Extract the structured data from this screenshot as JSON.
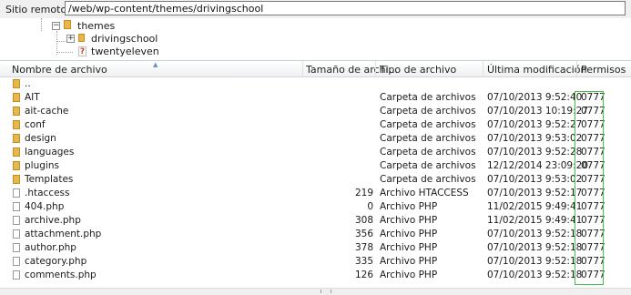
{
  "pathbar": {
    "label": "Sitio remoto:",
    "value": "/web/wp-content/themes/drivingschool"
  },
  "tree": {
    "nodes": [
      {
        "label": "themes",
        "icon": "folder-open-icon"
      },
      {
        "label": "drivingschool",
        "icon": "folder-icon",
        "expander": "+"
      },
      {
        "label": "twentyeleven",
        "icon": "unknown-folder-icon"
      }
    ]
  },
  "columns": {
    "name": "Nombre de archivo",
    "size": "Tamaño de archi...",
    "type": "Tipo de archivo",
    "modified": "Última modificación",
    "perms": "Permisos"
  },
  "files": [
    {
      "name": "..",
      "size": "",
      "type": "",
      "modified": "",
      "perms": "",
      "kind": "folder"
    },
    {
      "name": "AIT",
      "size": "",
      "type": "Carpeta de archivos",
      "modified": "07/10/2013 9:52:40",
      "perms": "0777",
      "kind": "folder"
    },
    {
      "name": "ait-cache",
      "size": "",
      "type": "Carpeta de archivos",
      "modified": "07/10/2013 10:19:27",
      "perms": "0777",
      "kind": "folder"
    },
    {
      "name": "conf",
      "size": "",
      "type": "Carpeta de archivos",
      "modified": "07/10/2013 9:52:27",
      "perms": "0777",
      "kind": "folder"
    },
    {
      "name": "design",
      "size": "",
      "type": "Carpeta de archivos",
      "modified": "07/10/2013 9:53:02",
      "perms": "0777",
      "kind": "folder"
    },
    {
      "name": "languages",
      "size": "",
      "type": "Carpeta de archivos",
      "modified": "07/10/2013 9:52:28",
      "perms": "0777",
      "kind": "folder"
    },
    {
      "name": "plugins",
      "size": "",
      "type": "Carpeta de archivos",
      "modified": "12/12/2014 23:09:20",
      "perms": "0777",
      "kind": "folder"
    },
    {
      "name": "Templates",
      "size": "",
      "type": "Carpeta de archivos",
      "modified": "07/10/2013 9:53:02",
      "perms": "0777",
      "kind": "folder"
    },
    {
      "name": ".htaccess",
      "size": "219",
      "type": "Archivo HTACCESS",
      "modified": "07/10/2013 9:52:17",
      "perms": "0777",
      "kind": "file"
    },
    {
      "name": "404.php",
      "size": "0",
      "type": "Archivo PHP",
      "modified": "11/02/2015 9:49:41",
      "perms": "0777",
      "kind": "file"
    },
    {
      "name": "archive.php",
      "size": "308",
      "type": "Archivo PHP",
      "modified": "11/02/2015 9:49:41",
      "perms": "0777",
      "kind": "file"
    },
    {
      "name": "attachment.php",
      "size": "356",
      "type": "Archivo PHP",
      "modified": "07/10/2013 9:52:18",
      "perms": "0777",
      "kind": "file"
    },
    {
      "name": "author.php",
      "size": "378",
      "type": "Archivo PHP",
      "modified": "07/10/2013 9:52:18",
      "perms": "0777",
      "kind": "file"
    },
    {
      "name": "category.php",
      "size": "335",
      "type": "Archivo PHP",
      "modified": "07/10/2013 9:52:18",
      "perms": "0777",
      "kind": "file"
    },
    {
      "name": "comments.php",
      "size": "126",
      "type": "Archivo PHP",
      "modified": "07/10/2013 9:52:18",
      "perms": "0777",
      "kind": "file"
    }
  ]
}
